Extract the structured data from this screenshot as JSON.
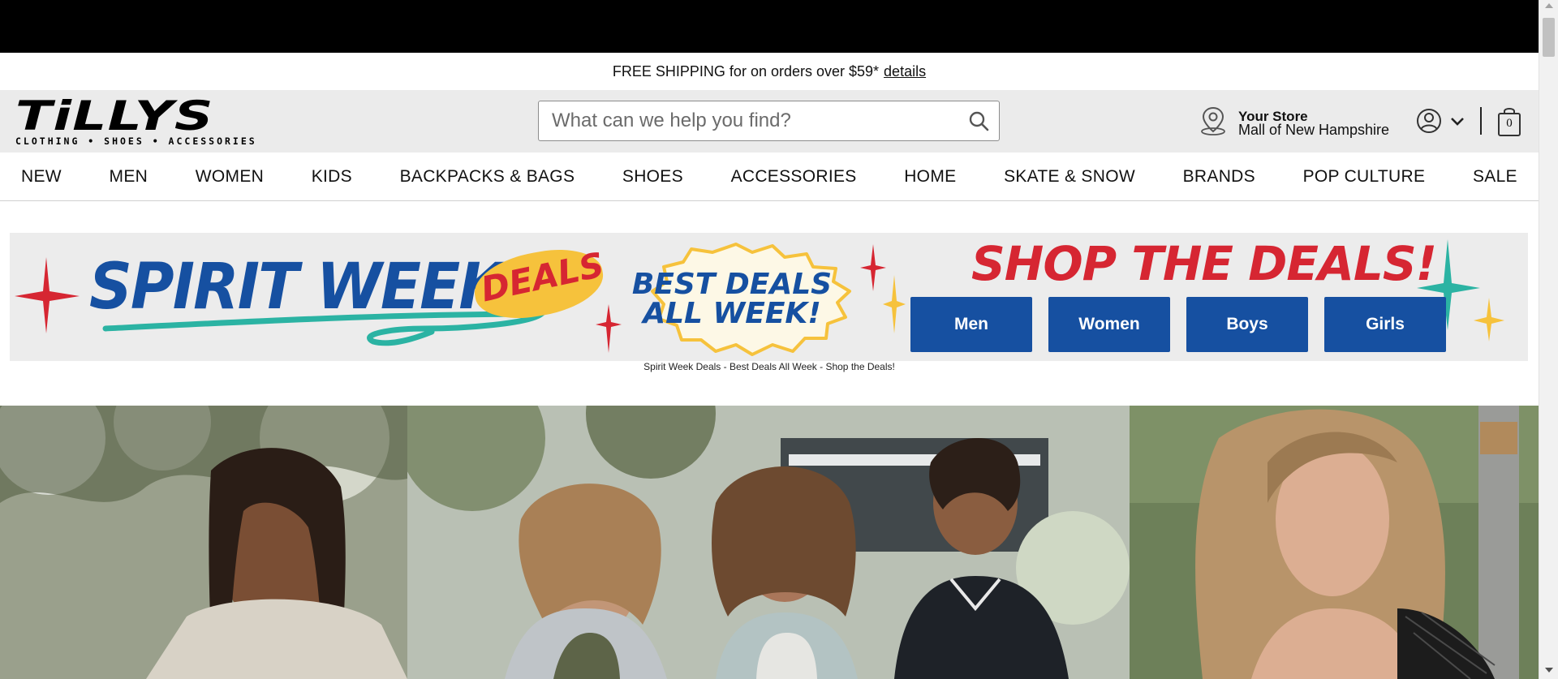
{
  "promo": {
    "text": "FREE SHIPPING for on orders over $59*",
    "link": "details"
  },
  "header": {
    "logo": {
      "wordmark": "TiLLYS",
      "tagline": "CLOTHING • SHOES • ACCESSORIES"
    },
    "search": {
      "placeholder": "What can we help you find?",
      "icon": "search-icon"
    },
    "store": {
      "label": "Your Store",
      "name": "Mall of New Hampshire",
      "icon": "location-pin-icon"
    },
    "account": {
      "icon": "user-icon",
      "dropdown_icon": "chevron-down-icon"
    },
    "cart": {
      "icon": "bag-icon",
      "count": "0"
    }
  },
  "nav": {
    "items": [
      "NEW",
      "MEN",
      "WOMEN",
      "KIDS",
      "BACKPACKS & BAGS",
      "SHOES",
      "ACCESSORIES",
      "HOME",
      "SKATE & SNOW",
      "BRANDS",
      "POP CULTURE",
      "SALE"
    ]
  },
  "banner": {
    "headline": "SPIRIT WEEK",
    "deals_tag": "DEALS",
    "badge_line1": "BEST DEALS",
    "badge_line2": "ALL WEEK!",
    "shop_title": "SHOP THE DEALS!",
    "buttons": [
      "Men",
      "Women",
      "Boys",
      "Girls"
    ],
    "caption": "Spirit Week Deals - Best Deals All Week - Shop the Deals!",
    "colors": {
      "background": "#ececec",
      "blue": "#1650a1",
      "red": "#d62632",
      "yellow": "#f6c23c",
      "teal": "#2bb3a3"
    }
  }
}
